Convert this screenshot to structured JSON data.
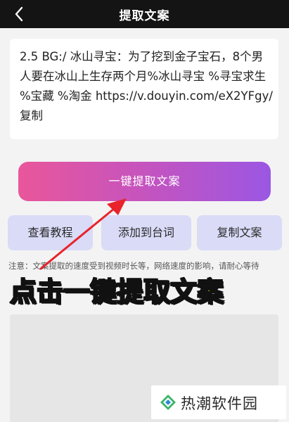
{
  "header": {
    "back_icon": "chevron-left-icon",
    "title": "提取文案"
  },
  "share_text": {
    "content": "2.5 BG:/ 冰山寻宝：为了挖到金子宝石，8个男人要在冰山上生存两个月%冰山寻宝 %寻宝求生 %宝藏  %淘金 https://v.douyin.com/eX2YFgy/ 复制"
  },
  "actions": {
    "extract_label": "一键提取文案",
    "tutorial_label": "查看教程",
    "add_to_script_label": "添加到台词",
    "copy_label": "复制文案"
  },
  "note": {
    "text": "注意：文案提取的速度受到视频时长等，网络速度的影响，请耐心等待"
  },
  "annotation": {
    "callout_text": "点击一键提取文案",
    "callout_color": "#ffe400",
    "arrow_color": "#e8232a"
  },
  "watermark": {
    "logo_icon": "diamond-logo-icon",
    "text": "热潮软件园"
  },
  "colors": {
    "gradient_start": "#e9569a",
    "gradient_end": "#9b57e3",
    "secondary_button": "#d9dbf7",
    "topbar": "#141414"
  }
}
